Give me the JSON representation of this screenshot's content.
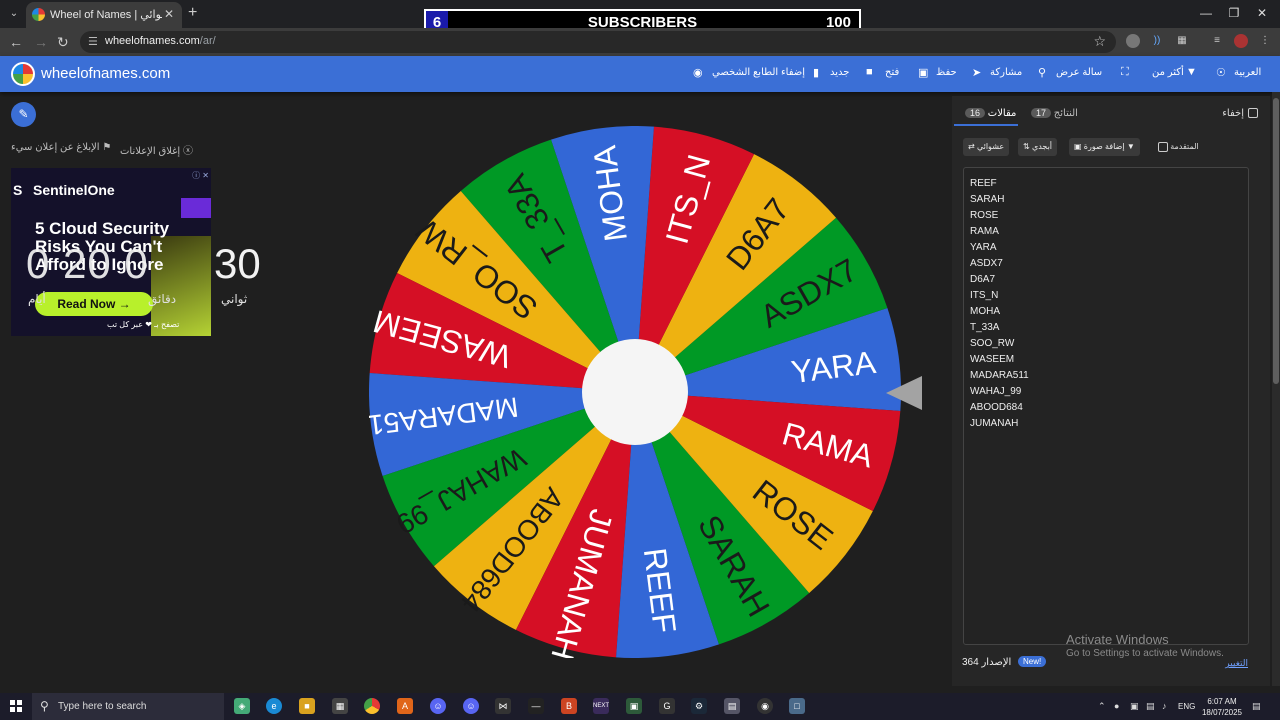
{
  "browser": {
    "tab_title": "Wheel of Names | ‫اسم العشوائي",
    "url_host": "wheelofnames.com",
    "url_path": "/ar/",
    "tab_close": "✕",
    "new_tab": "+",
    "tab_list": "⌄"
  },
  "overlay": {
    "subscriber_count": "6",
    "label": "SUBSCRIBERS",
    "goal": "100"
  },
  "header": {
    "logo_text": "wheelofnames.com",
    "language": "العربية",
    "more": "أكثر من",
    "fullscreen": "",
    "slideshow": "سالة عرض",
    "share": "مشاركة",
    "save": "حفظ",
    "open": "فتح",
    "new": "جديد",
    "customize": "إضفاء الطابع الشخصي"
  },
  "left": {
    "close_ads": "إغلاق الإعلانات",
    "report_ad": "الإبلاغ عن إعلان سيء",
    "ad": {
      "brand": "SentinelOne",
      "headline": "5 Cloud Security Risks You Can't Afford to Ignore",
      "cta": "Read Now →",
      "sub": "تصفح بـ ❤ عبر كل تب"
    },
    "timer": {
      "main": "0  20  0",
      "seconds": "30",
      "label_seconds": "ثواني",
      "label_minutes": "دقائق",
      "label_days": "أيام"
    }
  },
  "wheel": {
    "colors": [
      "#3367d6",
      "#009925",
      "#eeb211",
      "#d50f25"
    ],
    "segments": [
      "YARA",
      "ASDX7",
      "D6A7",
      "ITS_N",
      "MOHA",
      "T_33A",
      "SOO_RW",
      "WASEEM",
      "MADARA511",
      "WAHAJ_99",
      "ABOOD684",
      "JUMANAH",
      "REEF",
      "SARAH",
      "ROSE",
      "RAMA"
    ]
  },
  "panel": {
    "tab_entries": "مقالات",
    "entries_count": "16",
    "tab_results": "النتائج",
    "results_count": "17",
    "hide": "إخفاء",
    "shuffle": "عشوائي",
    "sort": "أبجدي",
    "add_image": "إضافة صورة",
    "advanced": "المتقدمة",
    "entries": [
      "REEF",
      "SARAH",
      "ROSE",
      "RAMA",
      "YARA",
      "ASDX7",
      "D6A7",
      "ITS_N",
      "MOHA",
      "T_33A",
      "SOO_RW",
      "WASEEM",
      "MADARA511",
      "WAHAJ_99",
      "ABOOD684",
      "JUMANAH"
    ],
    "version_label": "الإصدار",
    "version": "364",
    "new_badge": "New!",
    "changelog": "التغيير"
  },
  "windows": {
    "activate_title": "Activate Windows",
    "activate_sub": "Go to Settings to activate Windows.",
    "search_placeholder": "Type here to search",
    "lang": "ENG",
    "time": "6:07 AM",
    "date": "18/07/2025"
  }
}
